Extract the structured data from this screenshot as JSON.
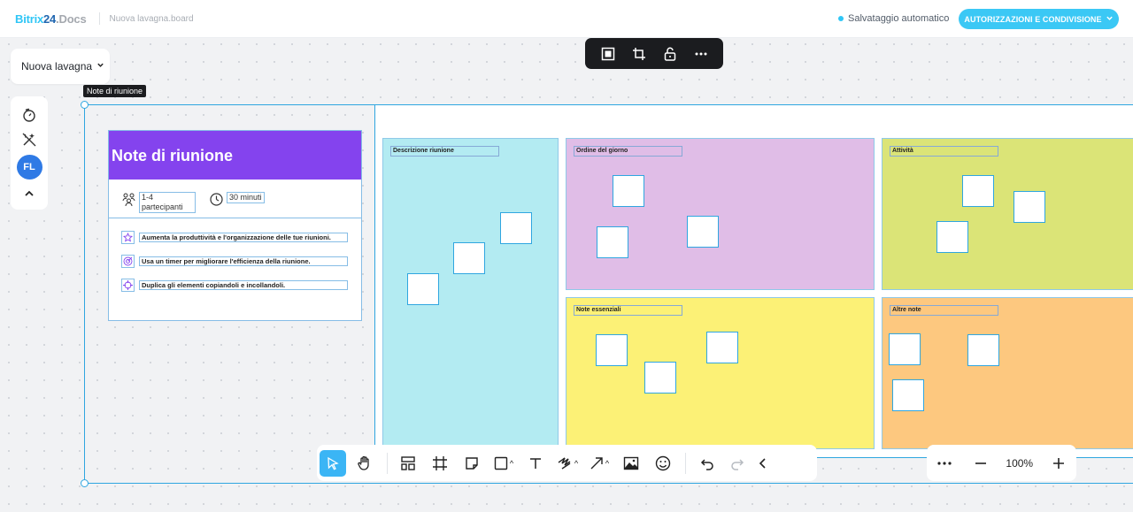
{
  "header": {
    "logo_main": "Bitrix",
    "logo_num": "24",
    "logo_suffix": ".Docs",
    "document_name": "Nuova lavagna.board",
    "autosave_text": "Salvataggio automatico",
    "share_button": "AUTORIZZAZIONI E CONDIVISIONE"
  },
  "top_toolbar": {
    "icons": [
      "frame-icon",
      "crop-icon",
      "unlock-icon",
      "more-icon"
    ]
  },
  "board_select": {
    "label": "Nuova lavagna"
  },
  "tooltip": {
    "text": "Note di riunione"
  },
  "left_panel": {
    "icons": [
      "timer-icon",
      "magic-off-icon"
    ],
    "avatar_initials": "FL"
  },
  "notes_card": {
    "title": "Note di riunione",
    "participants": "1-4 partecipanti",
    "duration": "30 minuti",
    "tips": [
      "Aumenta la produttività e l'organizzazione delle tue riunioni.",
      "Usa un timer per migliorare l'efficienza della riunione.",
      "Duplica gli elementi copiandoli e incollandoli."
    ]
  },
  "sections": [
    {
      "label": "Descrizione riunione",
      "color": "#b3ebf2"
    },
    {
      "label": "Ordine del giorno",
      "color": "#e0bde7"
    },
    {
      "label": "Attività",
      "color": "#dbe477"
    },
    {
      "label": "Note essenziali",
      "color": "#fcf176"
    },
    {
      "label": "Altre note",
      "color": "#fdc87f"
    }
  ],
  "bottom_toolbar": {
    "tools": [
      "select-tool",
      "hand-tool",
      "layout-tool",
      "frame-tool",
      "sticky-tool",
      "shape-tool",
      "text-tool",
      "pen-tool",
      "arrow-tool",
      "image-tool",
      "emoji-tool",
      "undo",
      "redo",
      "collapse"
    ]
  },
  "zoom": {
    "value": "100%"
  },
  "colors": {
    "accent": "#3bc8f5",
    "purple_header": "#8443ee",
    "selection": "#2fa6e0"
  }
}
